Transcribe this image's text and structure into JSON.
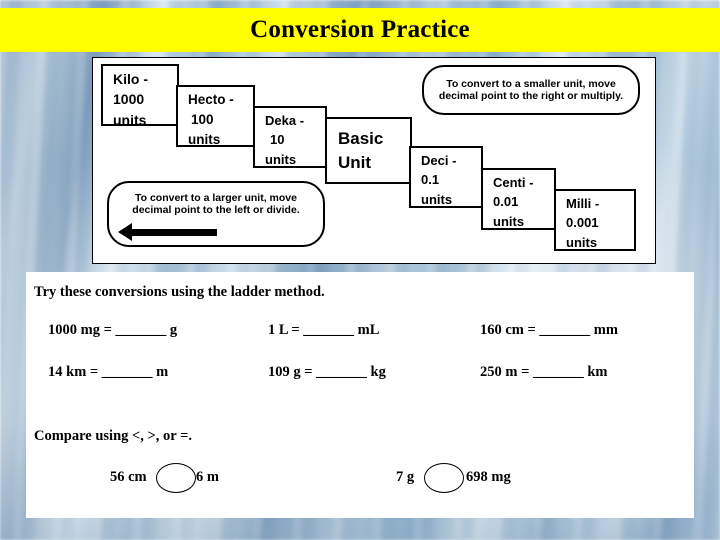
{
  "slide": {
    "title": "Conversion Practice"
  },
  "ladder": {
    "steps": [
      {
        "name": "kilo",
        "line1": "Kilo -",
        "line2": "1000",
        "line3": "units"
      },
      {
        "name": "hecto",
        "line1": "Hecto -",
        "line2": "100",
        "line3": "units"
      },
      {
        "name": "deka",
        "line1": "Deka -",
        "line2": "10",
        "line3": "units"
      },
      {
        "name": "basic",
        "line1": "Basic",
        "line2": "Unit",
        "line3": ""
      },
      {
        "name": "deci",
        "line1": "Deci -",
        "line2": "0.1",
        "line3": "units"
      },
      {
        "name": "centi",
        "line1": "Centi -",
        "line2": "0.01",
        "line3": "units"
      },
      {
        "name": "milli",
        "line1": "Milli -",
        "line2": "0.001",
        "line3": "units"
      }
    ],
    "note_smaller": "To convert to a smaller unit, move decimal  point to the right or multiply.",
    "note_larger": "To convert to a larger unit, move decimal point to the left or divide."
  },
  "instructions": {
    "conversions_lead": "Try these conversions using the ladder method.",
    "compare_lead": "Compare using <, >, or =."
  },
  "conversions": [
    {
      "id": "c1",
      "text": "1000 mg = _______ g"
    },
    {
      "id": "c2",
      "text": "1 L = _______ mL"
    },
    {
      "id": "c3",
      "text": "160 cm = _______ mm"
    },
    {
      "id": "c4",
      "text": "14 km = _______ m"
    },
    {
      "id": "c5",
      "text": "109 g = _______ kg"
    },
    {
      "id": "c6",
      "text": "250 m = _______ km"
    }
  ],
  "comparisons": [
    {
      "id": "p1",
      "left": "56 cm",
      "right": "6 m"
    },
    {
      "id": "p2",
      "left": "7 g",
      "right": "698 mg"
    }
  ],
  "colors": {
    "title_band": "#ffff00",
    "text": "#000000",
    "panel": "#ffffff"
  }
}
